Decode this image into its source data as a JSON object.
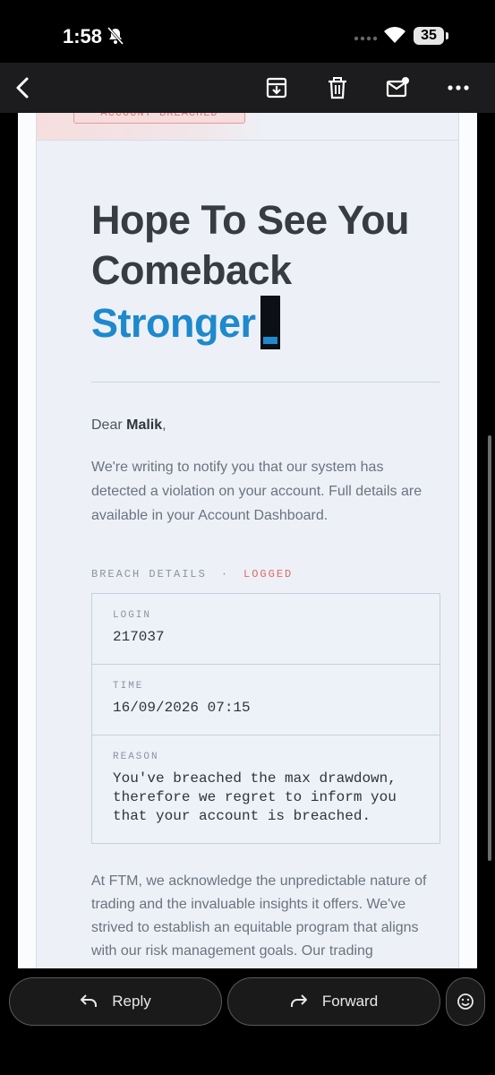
{
  "status_bar": {
    "time": "1:58",
    "battery": "35"
  },
  "email": {
    "status_pill": "ACCOUNT BREACHED",
    "headline_line1": "Hope To See You",
    "headline_line2": "Comeback",
    "headline_accent": "Stronger",
    "greeting_prefix": "Dear ",
    "greeting_name": "Malik",
    "greeting_suffix": ",",
    "intro": "We're writing to notify you that our system has detected a violation on your account. Full details are available in your Account Dashboard.",
    "section_label": "BREACH DETAILS",
    "section_separator": "·",
    "section_status": "LOGGED",
    "details": [
      {
        "label": "LOGIN",
        "value": "217037"
      },
      {
        "label": "TIME",
        "value": "16/09/2026 07:15"
      },
      {
        "label": "REASON",
        "value": "You've breached the max drawdown, therefore we regret to inform you that your account is breached."
      }
    ],
    "body_text": "At FTM, we acknowledge the unpredictable nature of trading and the invaluable insights it offers. We've strived to establish an equitable program that aligns with our risk management goals. Our trading"
  },
  "actions": {
    "reply": "Reply",
    "forward": "Forward"
  },
  "colors": {
    "accent": "#1e89cc",
    "alert": "#e06666",
    "card_bg": "#edf1f7"
  }
}
